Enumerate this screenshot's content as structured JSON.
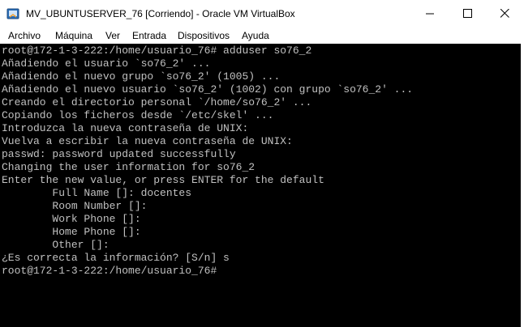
{
  "window": {
    "title": "MV_UBUNTUSERVER_76 [Corriendo] - Oracle VM VirtualBox",
    "icon": "virtualbox-icon",
    "controls": [
      "minimize",
      "maximize",
      "close"
    ]
  },
  "menu": {
    "items": [
      "Archivo",
      "Máquina",
      "Ver",
      "Entrada",
      "Dispositivos",
      "Ayuda"
    ]
  },
  "terminal": {
    "lines": [
      "root@172-1-3-222:/home/usuario_76# adduser so76_2",
      "Añadiendo el usuario `so76_2' ...",
      "Añadiendo el nuevo grupo `so76_2' (1005) ...",
      "Añadiendo el nuevo usuario `so76_2' (1002) con grupo `so76_2' ...",
      "Creando el directorio personal `/home/so76_2' ...",
      "Copiando los ficheros desde `/etc/skel' ...",
      "Introduzca la nueva contraseña de UNIX:",
      "Vuelva a escribir la nueva contraseña de UNIX:",
      "passwd: password updated successfully",
      "Changing the user information for so76_2",
      "Enter the new value, or press ENTER for the default",
      "        Full Name []: docentes",
      "        Room Number []:",
      "        Work Phone []:",
      "        Home Phone []:",
      "        Other []:",
      "¿Es correcta la información? [S/n] s",
      "root@172-1-3-222:/home/usuario_76#"
    ]
  },
  "colors": {
    "terminal_bg": "#000000",
    "terminal_fg": "#c0c0c0",
    "chrome_bg": "#ffffff"
  }
}
